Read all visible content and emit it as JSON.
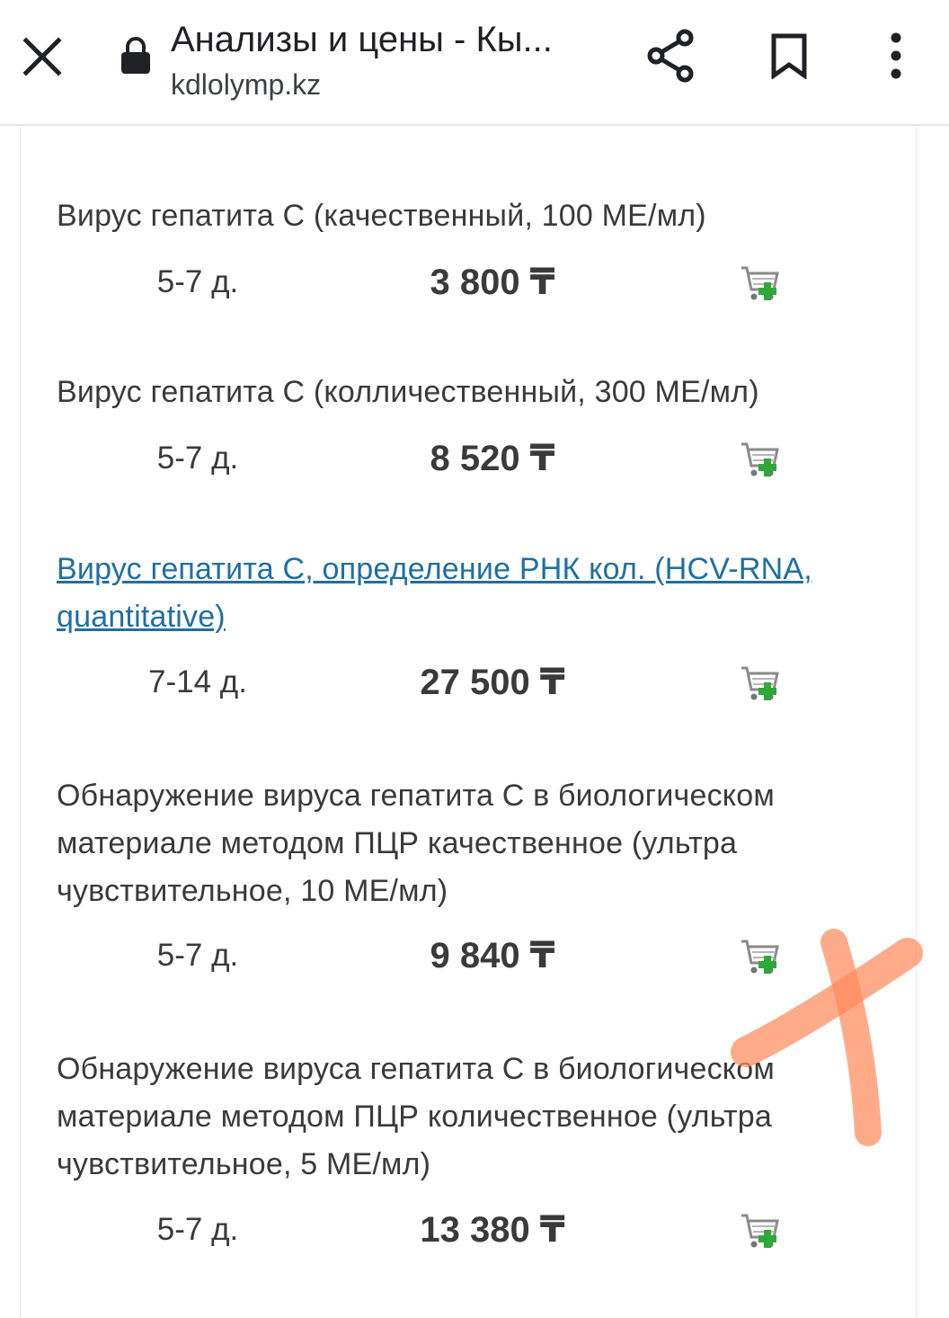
{
  "browser": {
    "title": "Анализы и цены - Кы...",
    "url": "kdlolymp.kz",
    "icons": {
      "close": "close-icon",
      "lock": "lock-icon",
      "share": "share-icon",
      "bookmark": "bookmark-icon",
      "menu": "more-vert-icon"
    }
  },
  "items": [
    {
      "name": "Вирус гепатита C (качественный, 100 МЕ/мл)",
      "term": "5-7 д.",
      "price": "3 800 ₸",
      "is_link": false
    },
    {
      "name": "Вирус гепатита C (колличественный, 300 МЕ/мл)",
      "term": "5-7 д.",
      "price": "8 520 ₸",
      "is_link": false
    },
    {
      "name": "Вирус гепатита С, определение РНК кол. (HCV-RNA, quantitative)",
      "term": "7-14 д.",
      "price": "27 500 ₸",
      "is_link": true
    },
    {
      "name": "Обнаружение вируса гепатита С в биологическом материале методом ПЦР качественное (ультра чувствительное, 10 МЕ/мл)",
      "term": "5-7 д.",
      "price": "9 840 ₸",
      "is_link": false
    },
    {
      "name": "Обнаружение вируса гепатита С в биологическом материале методом ПЦР количественное (ультра чувствительное, 5 МЕ/мл)",
      "term": "5-7 д.",
      "price": "13 380 ₸",
      "is_link": false
    }
  ],
  "colors": {
    "link": "#1f6fa3",
    "text": "#3a3a3a",
    "overlay_mark": "#ff8a5c"
  }
}
